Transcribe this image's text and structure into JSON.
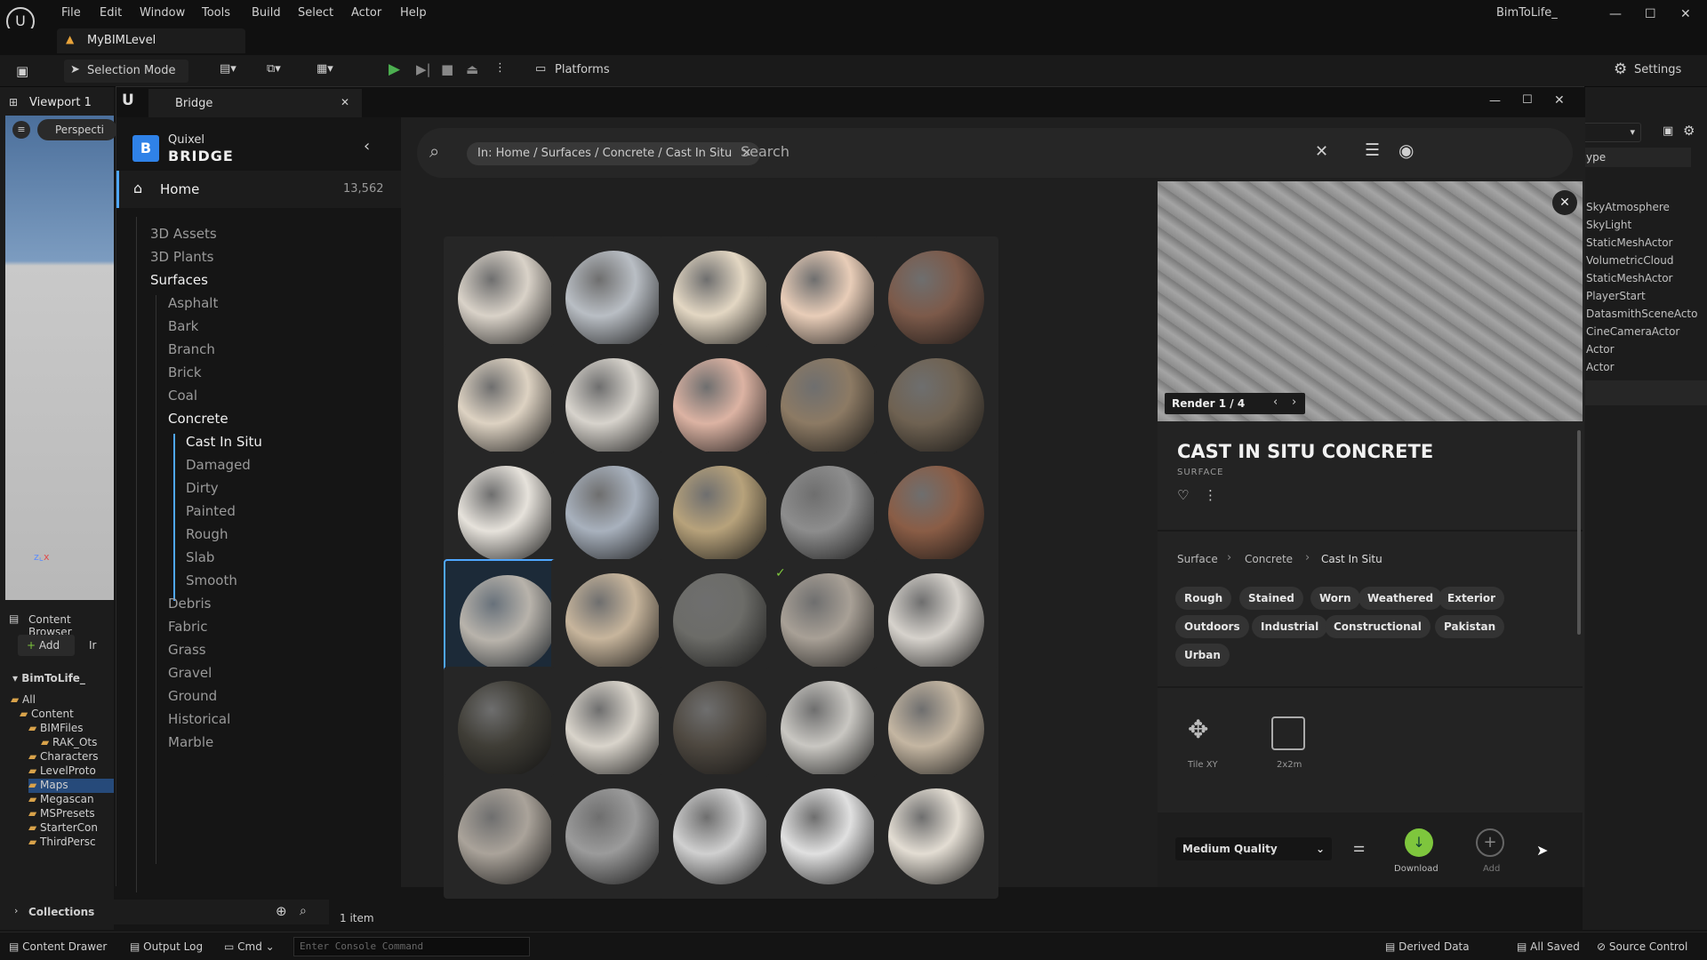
{
  "app": {
    "menu": [
      "File",
      "Edit",
      "Window",
      "Tools",
      "Build",
      "Select",
      "Actor",
      "Help"
    ],
    "project": "BimToLife_",
    "level_tab": "MyBIMLevel"
  },
  "toolbar": {
    "selection_mode": "Selection Mode",
    "platforms": "Platforms",
    "settings": "Settings"
  },
  "viewport": {
    "tab": "Viewport 1",
    "perspective": "Perspecti"
  },
  "content_browser": {
    "title": "Content Browser",
    "add": "Add",
    "import": "Ir",
    "root": "BimToLife_",
    "tree": [
      "All",
      "Content",
      "BIMFiles",
      "RAK_Ots",
      "Characters",
      "LevelProto",
      "Maps",
      "Megascan",
      "MSPresets",
      "StarterCon",
      "ThirdPersc"
    ],
    "collections": "Collections",
    "item_count": "1 item"
  },
  "outliner": {
    "header": "ype",
    "items": [
      "SkyAtmosphere",
      "SkyLight",
      "StaticMeshActor",
      "VolumetricCloud",
      "StaticMeshActor",
      "PlayerStart",
      "DatasmithSceneActo",
      "CineCameraActor",
      "Actor",
      "Actor"
    ]
  },
  "status": {
    "content_drawer": "Content Drawer",
    "output_log": "Output Log",
    "cmd": "Cmd",
    "console_placeholder": "Enter Console Command",
    "derived_data": "Derived Data",
    "all_saved": "All Saved",
    "source_control": "Source Control"
  },
  "bridge": {
    "title": "Bridge",
    "logo_top": "Quixel",
    "logo_bottom": "BRIDGE",
    "home": "Home",
    "home_count": "13,562",
    "nav": [
      "3D Assets",
      "3D Plants",
      "Surfaces",
      "Asphalt",
      "Bark",
      "Branch",
      "Brick",
      "Coal",
      "Concrete",
      "Cast In Situ",
      "Damaged",
      "Dirty",
      "Painted",
      "Rough",
      "Slab",
      "Smooth",
      "Debris",
      "Fabric",
      "Grass",
      "Gravel",
      "Ground",
      "Historical",
      "Marble"
    ],
    "search_chip": "In: Home / Surfaces / Concrete / Cast In Situ",
    "search_placeholder": "Search",
    "detail": {
      "render_label": "Render 1 / 4",
      "title": "CAST IN SITU CONCRETE",
      "type": "SURFACE",
      "breadcrumb": [
        "Surface",
        "Concrete",
        "Cast In Situ"
      ],
      "tags": [
        "Rough",
        "Stained",
        "Worn",
        "Weathered",
        "Exterior",
        "Outdoors",
        "Industrial",
        "Constructional",
        "Pakistan",
        "Urban"
      ],
      "tile": "Tile XY",
      "size": "2x2m",
      "quality": "Medium Quality",
      "download": "Download",
      "add": "Add"
    }
  },
  "colors": {
    "accent": "#4fa7ff",
    "download": "#7ec63d",
    "play": "#4caf50"
  },
  "spheres": [
    [
      "#d9d2c8",
      "#b9bec4",
      "#e3d7c3",
      "#e8cdb8",
      "#7c5a4a"
    ],
    [
      "#ddd2c2",
      "#d7d3cc",
      "#dcb3a3",
      "#8c7a64",
      "#6f6252"
    ],
    [
      "#e6e2db",
      "#a8b1bd",
      "#b7a27b",
      "#8d8d8d",
      "#8a5d46"
    ],
    [
      "#b8b3ab",
      "#c7b59c",
      "#6c6c68",
      "#a8a096",
      "#d6d2cc"
    ],
    [
      "#3f3d36",
      "#d9d4cb",
      "#4e4840",
      "#c9c7c2",
      "#c4b6a2"
    ],
    [
      "#aaa39a",
      "#9b9b9b",
      "#d0d0d0",
      "#e0e0e0",
      "#e3ddd3"
    ]
  ]
}
